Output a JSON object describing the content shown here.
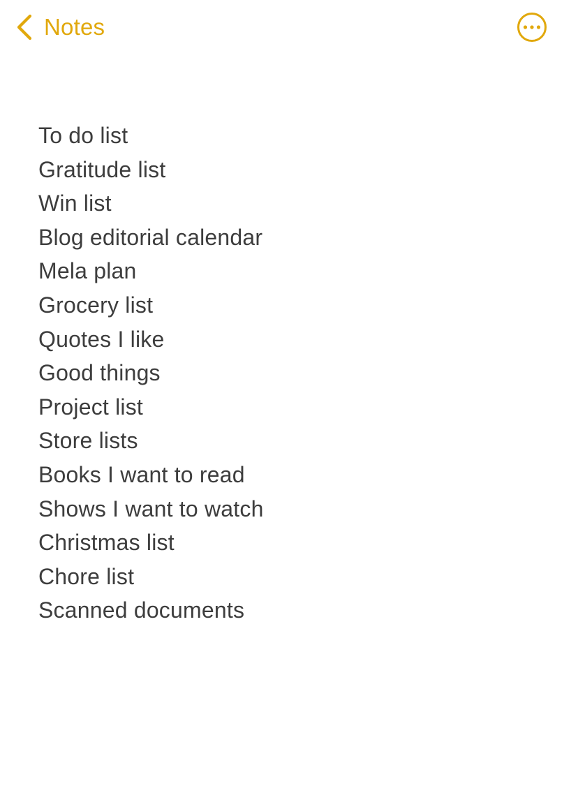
{
  "nav": {
    "back_label": "Notes",
    "back_icon": "chevron-left-icon",
    "more_icon": "ellipsis-circle-icon"
  },
  "colors": {
    "accent": "#e1a80c",
    "text": "#3d3d3d",
    "background": "#ffffff"
  },
  "note": {
    "lines": [
      "To do list",
      "Gratitude list",
      "Win list",
      "Blog editorial calendar",
      "Mela plan",
      "Grocery list",
      "Quotes I like",
      "Good things",
      "Project list",
      "Store lists",
      "Books I want to read",
      "Shows I want to watch",
      "Christmas list",
      "Chore list",
      "Scanned documents"
    ]
  }
}
